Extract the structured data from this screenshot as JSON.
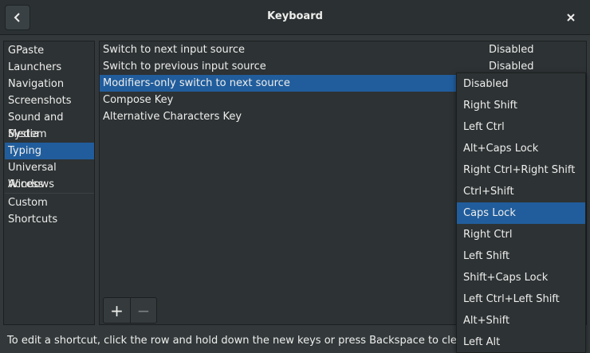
{
  "window": {
    "title": "Keyboard"
  },
  "icons": {
    "back": "chevron-left-icon",
    "close": "close-icon"
  },
  "colors": {
    "accent": "#215d9c",
    "background": "#33393b",
    "panel": "#2d3234"
  },
  "sidebar": {
    "items": [
      {
        "label": "GPaste"
      },
      {
        "label": "Launchers"
      },
      {
        "label": "Navigation"
      },
      {
        "label": "Screenshots"
      },
      {
        "label": "Sound and Media"
      },
      {
        "label": "System"
      },
      {
        "label": "Typing",
        "selected": true
      },
      {
        "label": "Universal Access"
      },
      {
        "label": "Windows"
      },
      {
        "label": "Custom Shortcuts"
      }
    ]
  },
  "shortcuts": {
    "rows": [
      {
        "name": "Switch to next input source",
        "value": "Disabled"
      },
      {
        "name": "Switch to previous input source",
        "value": "Disabled"
      },
      {
        "name": "Modifiers-only switch to next source",
        "value": "",
        "selected": true
      },
      {
        "name": "Compose Key",
        "value": ""
      },
      {
        "name": "Alternative Characters Key",
        "value": ""
      }
    ],
    "add_label": "+",
    "remove_label": "−"
  },
  "hint": "To edit a shortcut, click the row and hold down the new keys or press Backspace to clear.",
  "dropdown": {
    "selected": "Caps Lock",
    "options": [
      "Disabled",
      "Right Shift",
      "Left Ctrl",
      "Alt+Caps Lock",
      "Right Ctrl+Right Shift",
      "Ctrl+Shift",
      "Caps Lock",
      "Right Ctrl",
      "Left Shift",
      "Shift+Caps Lock",
      "Left Ctrl+Left Shift",
      "Alt+Shift",
      "Left Alt"
    ]
  }
}
